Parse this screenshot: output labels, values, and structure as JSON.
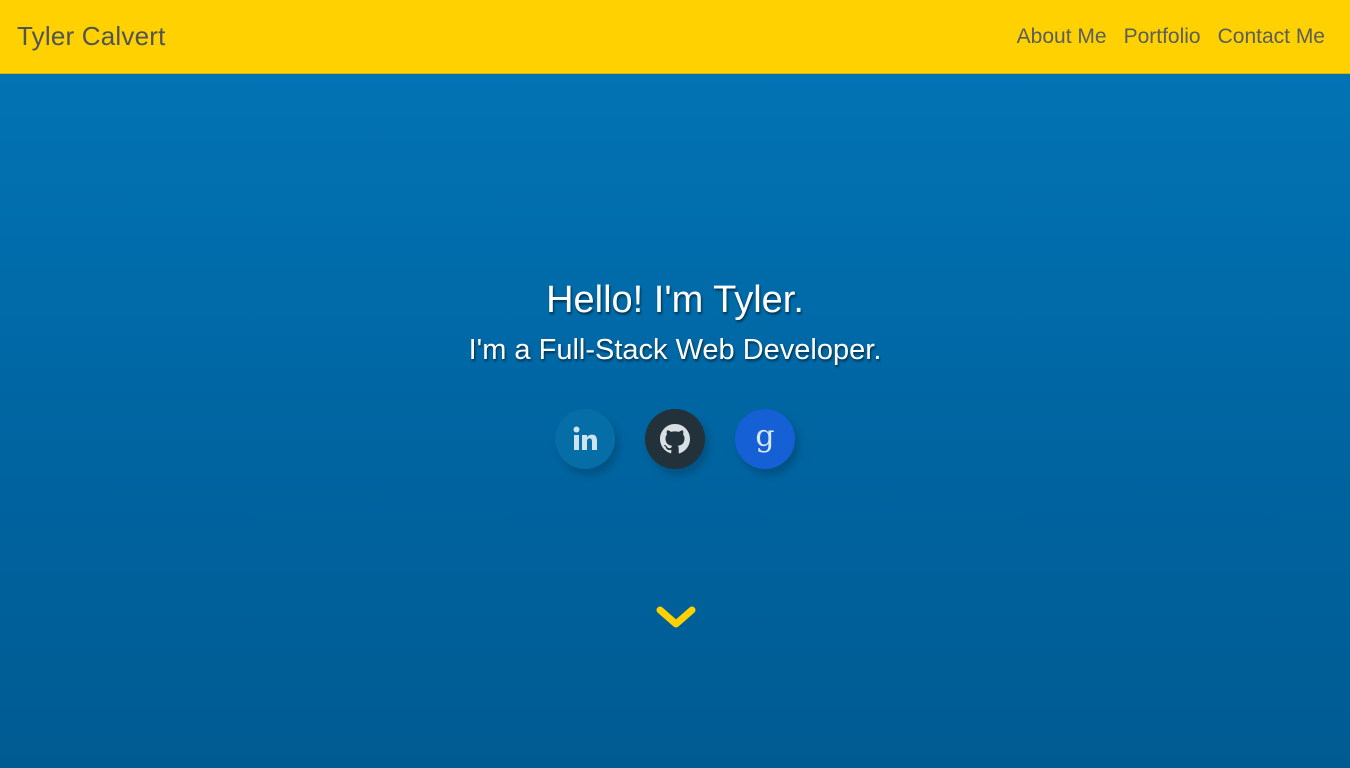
{
  "header": {
    "brand": "Tyler Calvert",
    "nav": [
      {
        "label": "About Me"
      },
      {
        "label": "Portfolio"
      },
      {
        "label": "Contact Me"
      }
    ]
  },
  "hero": {
    "headline": "Hello! I'm Tyler.",
    "subheadline": "I'm a Full-Stack Web Developer.",
    "social": [
      {
        "icon": "linkedin-icon"
      },
      {
        "icon": "github-icon"
      },
      {
        "icon": "google-icon"
      }
    ],
    "scroll_icon": "chevron-down-icon"
  },
  "colors": {
    "navbar": "#FFD100",
    "hero_top": "#0273b4",
    "hero_bottom": "#005b92",
    "accent": "#FFD100",
    "nav_text": "#5b5e5c"
  }
}
